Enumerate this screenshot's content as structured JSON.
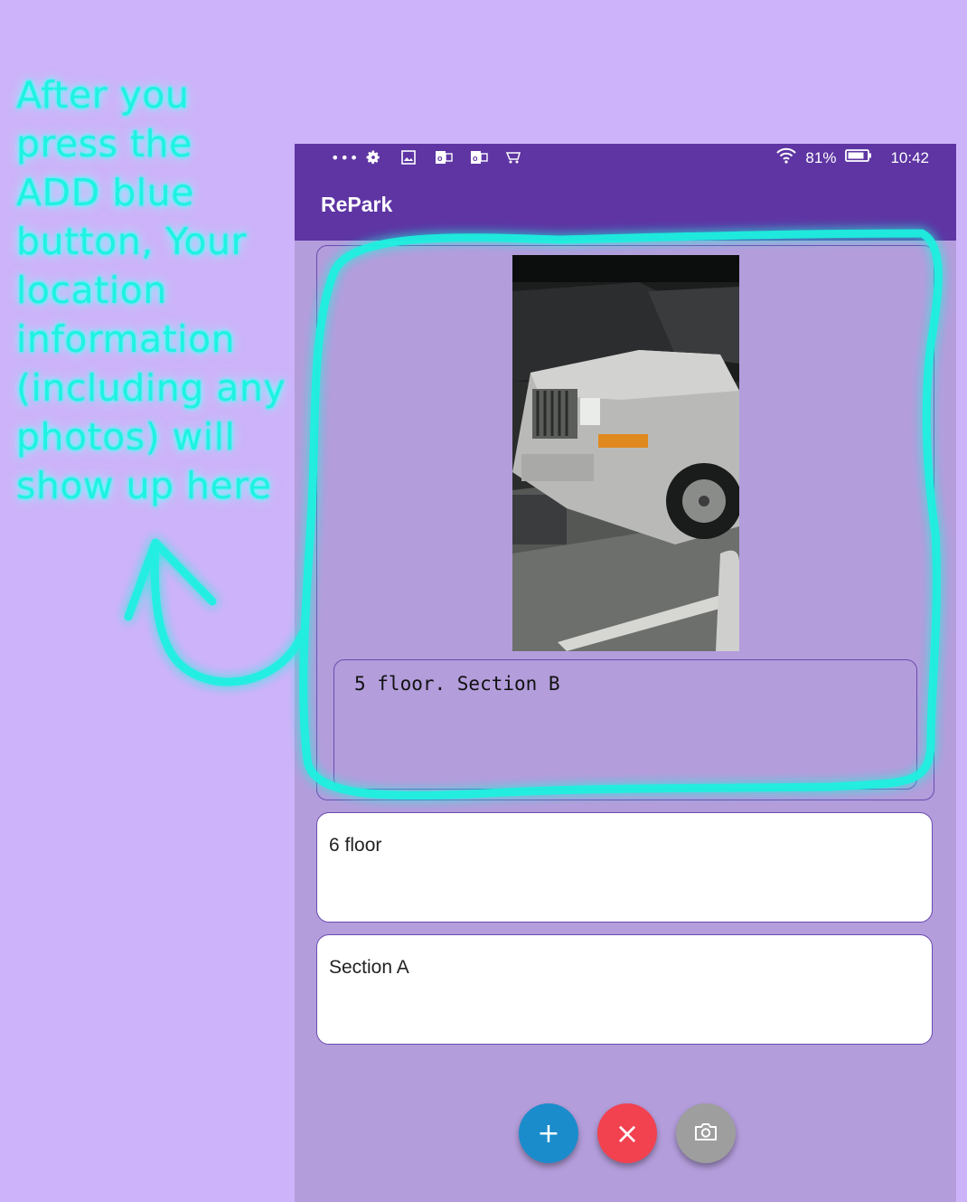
{
  "annotation": {
    "text": "After you\npress the\nADD blue\nbutton, Your\nlocation\ninformation\n(including any\nphotos) will\nshow up here"
  },
  "status_bar": {
    "more_icon": "more-horizontal-icon",
    "battery": "81%",
    "time": "10:42"
  },
  "app_bar": {
    "title": "RePark"
  },
  "saved_location": {
    "photo_alt": "parked car photo",
    "note": "5 floor.  Section B"
  },
  "entries": [
    {
      "text": "6 floor"
    },
    {
      "text": "Section A"
    }
  ],
  "actions": {
    "add_icon": "+",
    "clear_icon": "×",
    "camera_icon": "camera-icon"
  },
  "colors": {
    "page_bg": "#cdb3f9",
    "app_bar": "#5e35a3",
    "screen_bg": "#b39ddb",
    "add_button": "#1a8ccc",
    "clear_button": "#f2414f",
    "camera_button": "#9e9e9e",
    "highlight": "#1ff2e0"
  }
}
